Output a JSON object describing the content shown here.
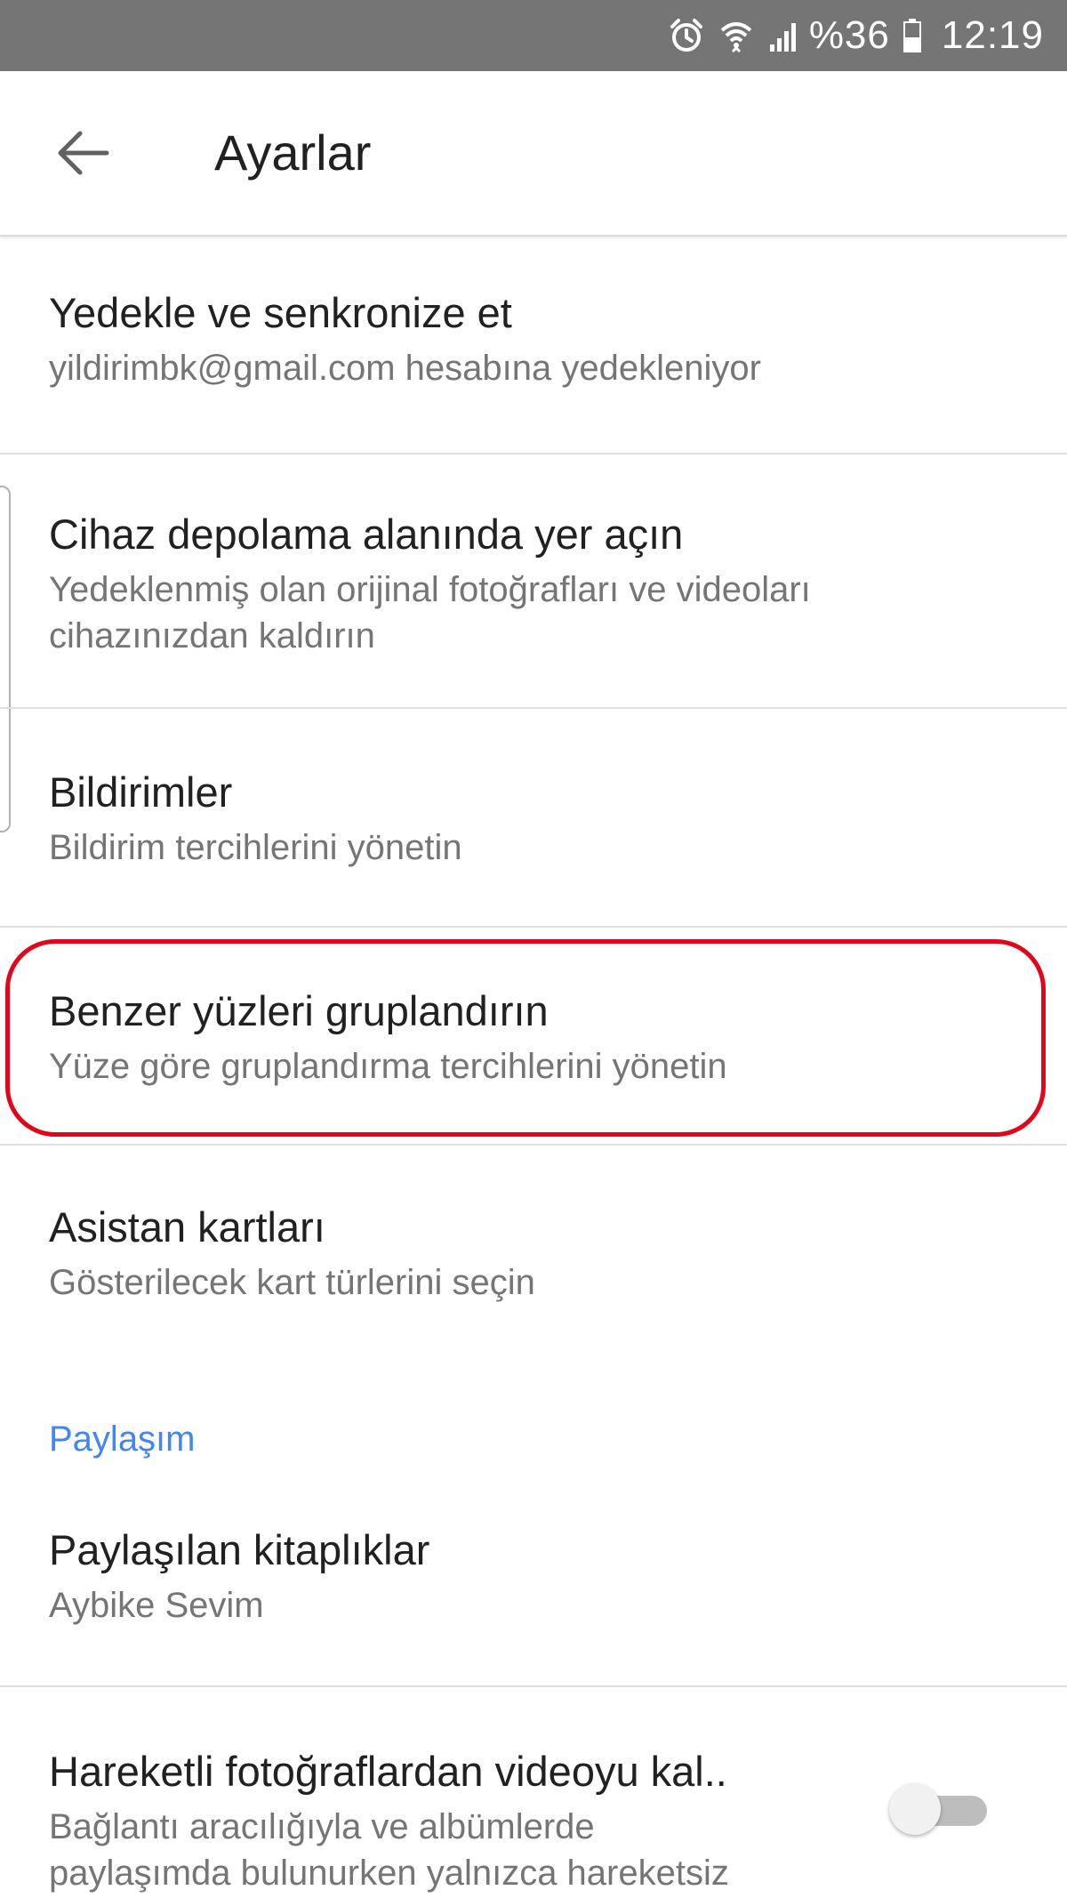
{
  "status_bar": {
    "battery_percent": "%36",
    "time": "12:19",
    "icons": [
      "alarm-icon",
      "wifi-icon",
      "signal-icon",
      "battery-icon"
    ]
  },
  "app_bar": {
    "title": "Ayarlar",
    "back_icon": "arrow-back-icon"
  },
  "settings": [
    {
      "title": "Yedekle ve senkronize et",
      "subtitle": "yildirimbk@gmail.com hesabına yedekleniyor"
    },
    {
      "title": "Cihaz depolama alanında yer açın",
      "subtitle_line1": "Yedeklenmiş olan orijinal fotoğrafları ve videoları",
      "subtitle_line2": "cihazınızdan kaldırın"
    },
    {
      "title": "Bildirimler",
      "subtitle": "Bildirim tercihlerini yönetin"
    },
    {
      "title": "Benzer yüzleri gruplandırın",
      "subtitle": "Yüze göre gruplandırma tercihlerini yönetin",
      "highlighted": true
    },
    {
      "title": "Asistan kartları",
      "subtitle": "Gösterilecek kart türlerini seçin"
    }
  ],
  "sharing_section": {
    "header": "Paylaşım",
    "items": [
      {
        "title": "Paylaşılan kitaplıklar",
        "subtitle": "Aybike Sevim"
      },
      {
        "title": "Hareketli fotoğraflardan videoyu kal..",
        "subtitle_line1": "Bağlantı aracılığıyla ve albümlerde",
        "subtitle_line2": "paylaşımda bulunurken yalnızca hareketsiz",
        "toggle_on": false
      }
    ]
  },
  "colors": {
    "status_bar": "#757575",
    "accent": "#4285f4",
    "highlight_ring": "#e3051b"
  }
}
